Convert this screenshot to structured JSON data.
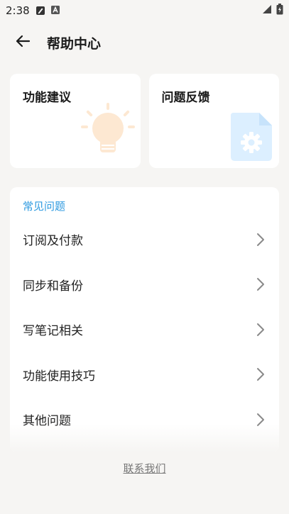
{
  "status_bar": {
    "time": "2:38",
    "left_icons": [
      "edit-note-icon",
      "a-badge-icon"
    ],
    "right_icons": [
      "cellular-signal-icon",
      "battery-icon"
    ]
  },
  "header": {
    "back_icon": "arrow-left-icon",
    "title": "帮助中心"
  },
  "cards": [
    {
      "title": "功能建议",
      "icon": "lightbulb-icon",
      "icon_color": "#fde8d2"
    },
    {
      "title": "问题反馈",
      "icon": "document-gear-icon",
      "icon_color": "#dcefff"
    }
  ],
  "faq": {
    "heading": "常见问题",
    "heading_color": "#2e9ae0",
    "items": [
      {
        "label": "订阅及付款"
      },
      {
        "label": "同步和备份"
      },
      {
        "label": "写笔记相关"
      },
      {
        "label": "功能使用技巧"
      },
      {
        "label": "其他问题"
      }
    ]
  },
  "footer": {
    "contact_label": "联系我们"
  }
}
